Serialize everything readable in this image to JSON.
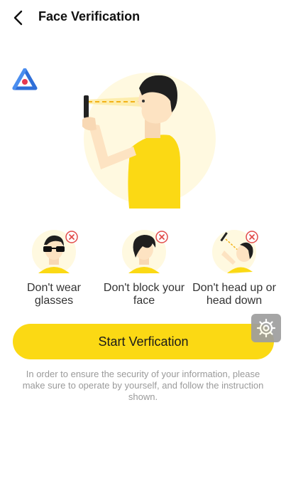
{
  "header": {
    "title": "Face Verification",
    "back_icon": "back-arrow-icon"
  },
  "tips": [
    {
      "label_line1": "Don't wear",
      "label_line2": "glasses",
      "icon": "no-glasses-icon"
    },
    {
      "label_line1": "Don't block your",
      "label_line2": "face",
      "icon": "no-block-face-icon"
    },
    {
      "label_line1": "Don't head up or",
      "label_line2": "head down",
      "icon": "no-head-tilt-icon"
    }
  ],
  "actions": {
    "start_label": "Start Verfication"
  },
  "notice": "In order to ensure the security of your information, please make sure to operate by yourself, and follow the instruction shown.",
  "colors": {
    "accent": "#fbd914",
    "error_badge": "#e14b4b",
    "body_text": "#9a9a9a"
  }
}
